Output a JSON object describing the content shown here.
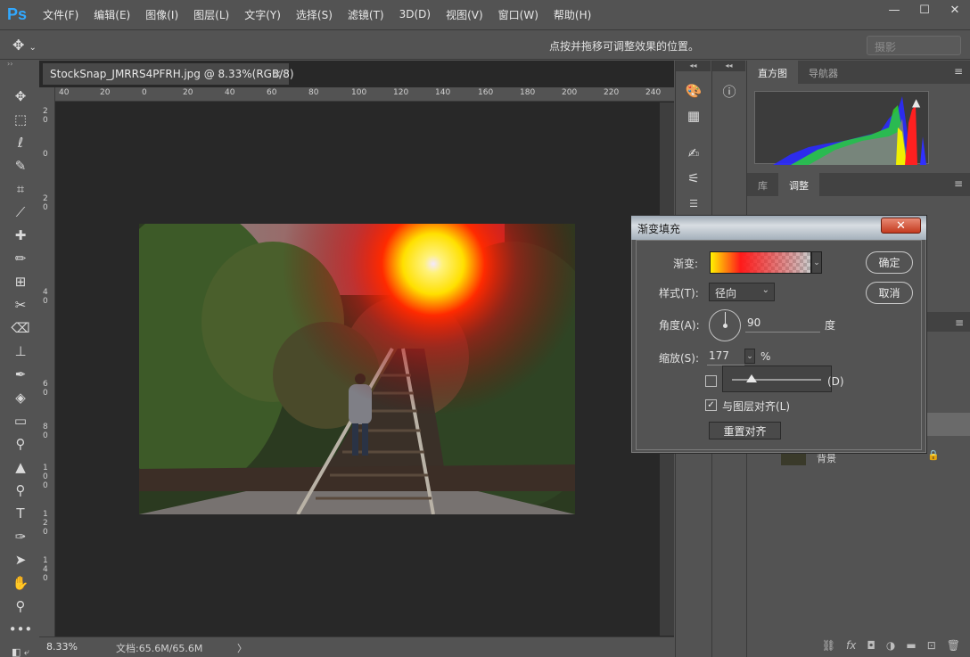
{
  "app": {
    "logo": "Ps"
  },
  "menu": [
    "文件(F)",
    "编辑(E)",
    "图像(I)",
    "图层(L)",
    "文字(Y)",
    "选择(S)",
    "滤镜(T)",
    "3D(D)",
    "视图(V)",
    "窗口(W)",
    "帮助(H)"
  ],
  "window_controls": {
    "minimize": "—",
    "maximize": "☐",
    "close": "✕"
  },
  "options_bar": {
    "hint": "点按并拖移可调整效果的位置。",
    "workspace": "摄影"
  },
  "document": {
    "tab_title": "StockSnap_JMRRS4PFRH.jpg @ 8.33%(RGB/8)",
    "tab_close": "×",
    "ruler_h": [
      "40",
      "20",
      "0",
      "20",
      "40",
      "60",
      "80",
      "100",
      "120",
      "140",
      "160",
      "180",
      "200",
      "220",
      "240"
    ],
    "ruler_v": [
      "2",
      "0",
      "0",
      "2",
      "0",
      "4",
      "0",
      "6",
      "0",
      "8",
      "0",
      "1",
      "0",
      "0",
      "1",
      "2",
      "0",
      "1",
      "4",
      "0"
    ],
    "zoom": "8.33%",
    "doc_info": "文档:65.6M/65.6M",
    "status_arrow": "〉"
  },
  "panels": {
    "tabs_top": [
      "直方图",
      "导航器"
    ],
    "tabs_mid": [
      "库",
      "调整"
    ],
    "layer_name": "背景"
  },
  "dialog": {
    "title": "渐变填充",
    "close": "✕",
    "gradient_label": "渐变:",
    "style_label": "样式(T):",
    "style_value": "径向",
    "angle_label": "角度(A):",
    "angle_value": "90",
    "angle_unit": "度",
    "scale_label": "缩放(S):",
    "scale_value": "177",
    "scale_unit": "%",
    "reverse_suffix": "(D)",
    "align_label": "与图层对齐(L)",
    "reset_align": "重置对齐",
    "ok": "确定",
    "cancel": "取消"
  },
  "colors": {
    "accent": "#31a8ff",
    "bg": "#535353",
    "canvas": "#282828"
  }
}
